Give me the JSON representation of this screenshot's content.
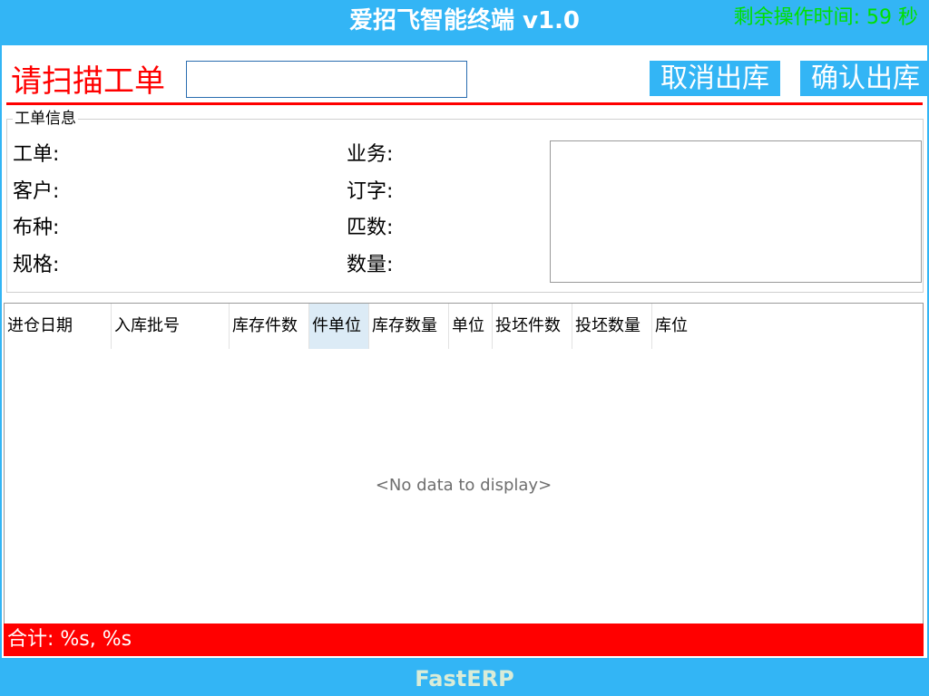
{
  "window": {
    "title": "爱招飞智能终端 v1.0",
    "timer_text": "剩余操作时间: 59 秒"
  },
  "scan": {
    "label": "请扫描工单",
    "input_value": "",
    "cancel_label": "取消出库",
    "confirm_label": "确认出库"
  },
  "info": {
    "group_title": "工单信息",
    "fields": {
      "work_order": "工单:",
      "business": "业务:",
      "customer": "客户:",
      "order_word": "订字:",
      "fabric": "布种:",
      "piece_count": "匹数:",
      "spec": "规格:",
      "quantity": "数量:"
    }
  },
  "grid": {
    "columns": [
      "进仓日期",
      "入库批号",
      "库存件数",
      "件单位",
      "库存数量",
      "单位",
      "投坯件数",
      "投坯数量",
      "库位"
    ],
    "active_column": "件单位",
    "rows": [],
    "empty_text": "<No data to display>",
    "total_text": "合计: %s,   %s"
  },
  "footer": {
    "brand": "FastERP"
  },
  "colors": {
    "accent_blue": "#33b5f5",
    "alert_red": "#ff0000",
    "timer_green": "#00e000"
  }
}
